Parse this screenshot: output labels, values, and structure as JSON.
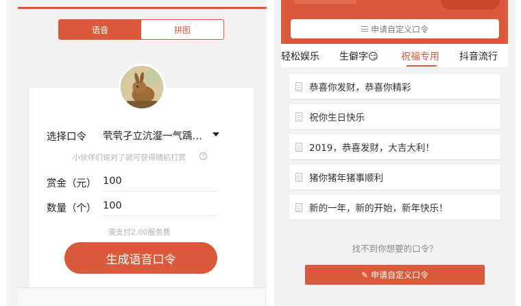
{
  "left": {
    "tabs": {
      "voice": "语音",
      "puzzle": "拼图"
    },
    "command_label": "选择口令",
    "command_value": "茕茕孑立沆瀣一气踽…",
    "hint": "小伙伴们说对了就可获得随机打赏",
    "amount_label": "赏金（元）",
    "amount_value": "100",
    "quantity_label": "数量（个）",
    "quantity_value": "100",
    "fee_text": "需支付2.00服务费",
    "generate_button": "生成语音口令"
  },
  "right": {
    "search_label": "申请自定义口令",
    "tabs": [
      {
        "label": "轻松娱乐"
      },
      {
        "label": "生僻字😏"
      },
      {
        "label": "祝福专用"
      },
      {
        "label": "抖音流行"
      }
    ],
    "items": [
      {
        "text": "恭喜你发财，恭喜你精彩"
      },
      {
        "text": "祝你生日快乐"
      },
      {
        "text": "2019，恭喜发财，大吉大利！"
      },
      {
        "text": "猪你猪年猪事顺利"
      },
      {
        "text": "新的一年，新的开始，新年快乐！"
      }
    ],
    "not_found": "找不到你想要的口令？",
    "apply_button": "申请自定义口令"
  },
  "colors": {
    "accent": "#dc5a3c",
    "background": "#f2f2f2"
  },
  "icons": [
    "help-icon",
    "caret-down-icon",
    "menu-icon",
    "document-icon",
    "pencil-icon"
  ]
}
